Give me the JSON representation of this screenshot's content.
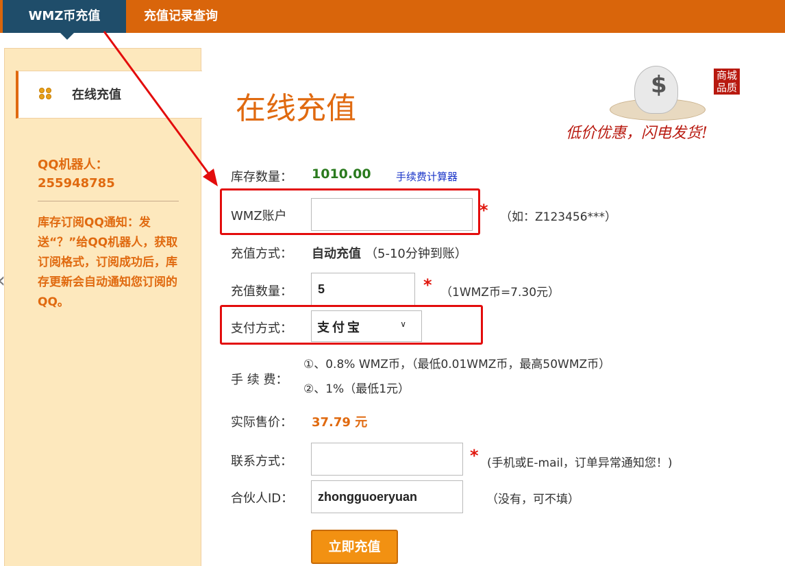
{
  "nav": {
    "tabs": [
      {
        "label": "WMZ币充值"
      },
      {
        "label": "充值记录查询"
      }
    ]
  },
  "sidebar": {
    "nav_label": "在线充值",
    "qq_title": "QQ机器人：",
    "qq_number": "255948785",
    "note": "库存订阅QQ通知：发送“？”给QQ机器人，获取订阅格式，订阅成功后，库存更新会自动通知您订阅的QQ。"
  },
  "main": {
    "title": "在线充值",
    "banner": {
      "stamp": "商城品质",
      "slogan": "低价优惠，闪电发货!"
    },
    "stock": {
      "label": "库存数量：",
      "value": "1010.00",
      "link": "手续费计算器"
    },
    "account": {
      "label": "WMZ账户",
      "value": "",
      "hint": "（如：Z123456***）"
    },
    "method": {
      "label": "充值方式：",
      "value": "自动充值",
      "note": "（5-10分钟到账）"
    },
    "quantity": {
      "label": "充值数量：",
      "value": "5",
      "hint": "（1WMZ币=7.30元）"
    },
    "payment": {
      "label": "支付方式：",
      "selected": "支付宝"
    },
    "fee": {
      "label": "手 续 费：",
      "line1": "①、0.8% WMZ币，（最低0.01WMZ币，最高50WMZ币）",
      "line2": "②、1%（最低1元）"
    },
    "price": {
      "label": "实际售价：",
      "value": "37.79 元"
    },
    "contact": {
      "label": "联系方式：",
      "value": "",
      "hint": "(手机或E-mail，订单异常通知您！)"
    },
    "partner": {
      "label": "合伙人ID：",
      "value": "zhongguoeryuan",
      "hint": "（没有，可不填）"
    },
    "submit_label": "立即充值"
  },
  "colors": {
    "nav_bar": "#d9650b",
    "nav_active": "#1f4d6a",
    "accent": "#e06a10",
    "stock_value": "#2a7a1e",
    "highlight_box": "#e30c0c",
    "sidebar_bg": "#fde8bd"
  }
}
